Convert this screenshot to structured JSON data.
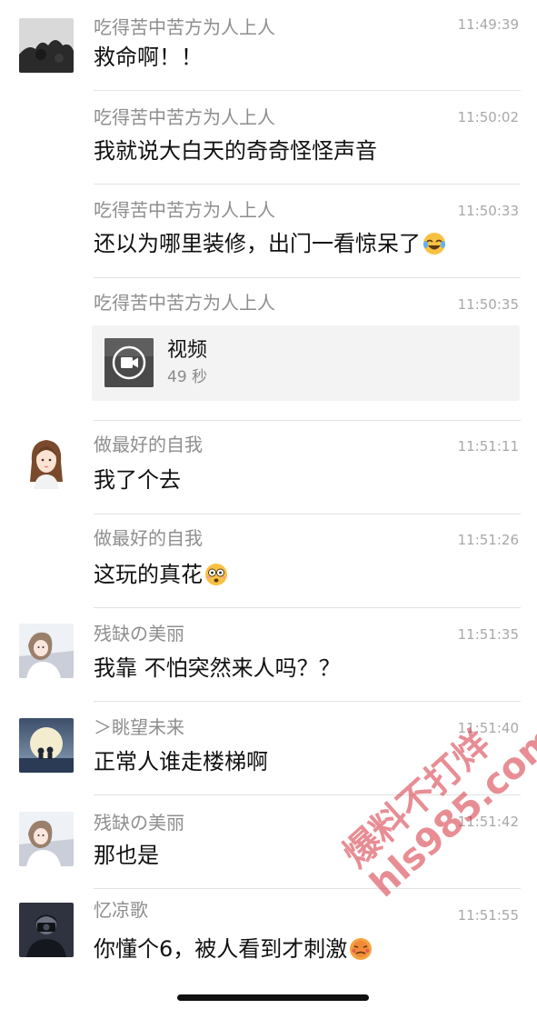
{
  "messages": [
    {
      "sender": "吃得苦中苦方为人上人",
      "time": "11:49:39",
      "text": "救命啊！！"
    },
    {
      "sender": "吃得苦中苦方为人上人",
      "time": "11:50:02",
      "text": "我就说大白天的奇奇怪怪声音"
    },
    {
      "sender": "吃得苦中苦方为人上人",
      "time": "11:50:33",
      "text": "还以为哪里装修，出门一看惊呆了"
    },
    {
      "sender": "吃得苦中苦方为人上人",
      "time": "11:50:35",
      "video_title": "视频",
      "video_duration": "49 秒"
    },
    {
      "sender": "做最好的自我",
      "time": "11:51:11",
      "text": "我了个去"
    },
    {
      "sender": "做最好的自我",
      "time": "11:51:26",
      "text": "这玩的真花"
    },
    {
      "sender": "残缺の美丽",
      "time": "11:51:35",
      "text": "我靠 不怕突然来人吗？？"
    },
    {
      "sender": "＞眺望未来",
      "time": "11:51:40",
      "text": "正常人谁走楼梯啊"
    },
    {
      "sender": "残缺の美丽",
      "time": "11:51:42",
      "text": "那也是"
    },
    {
      "sender": "忆凉歌",
      "time": "11:51:55",
      "text": "你懂个6，被人看到才刺激"
    }
  ],
  "watermark": {
    "line1": "爆料不打烊",
    "line2": "hls985.com"
  },
  "icons": {
    "emoji_laugh_cry": "laughing-crying-emoji-icon",
    "emoji_shocked": "shocked-face-emoji-icon",
    "emoji_blush": "blushing-face-emoji-icon",
    "video": "video-camera-icon"
  },
  "colors": {
    "sender": "#8e8e8e",
    "time": "#a8a8a8",
    "text": "#111111",
    "divider": "#e3e3e3",
    "video_card_bg": "#f3f3f3",
    "watermark": "#d6303c"
  }
}
